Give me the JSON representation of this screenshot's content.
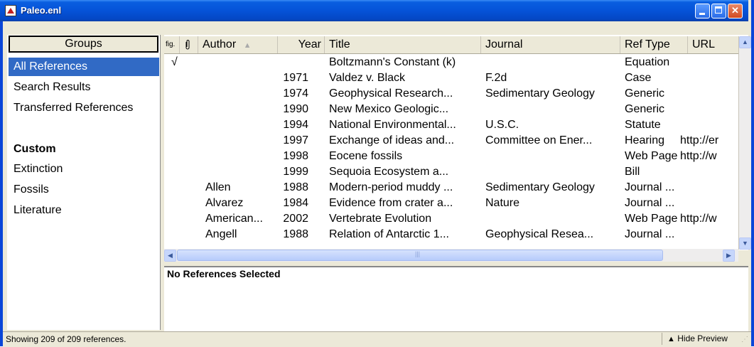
{
  "window": {
    "title": "Paleo.enl"
  },
  "groups": {
    "header": "Groups",
    "items": [
      {
        "label": "All References",
        "selected": true
      },
      {
        "label": "Search Results"
      },
      {
        "label": "Transferred References"
      }
    ],
    "custom_heading": "Custom",
    "custom_items": [
      "Extinction",
      "Fossils",
      "Literature"
    ]
  },
  "columns": {
    "figure_icon": "fig.",
    "attachment_icon": "paperclip-icon",
    "author": "Author",
    "year": "Year",
    "title": "Title",
    "journal": "Journal",
    "ref_type": "Ref Type",
    "url": "URL"
  },
  "references": [
    {
      "check": "√",
      "author": "",
      "year": "",
      "title": "Boltzmann's Constant (k)",
      "journal": "",
      "type": "Equation",
      "url": ""
    },
    {
      "check": "",
      "author": "",
      "year": "1971",
      "title": "Valdez v. Black",
      "journal": "F.2d",
      "type": "Case",
      "url": ""
    },
    {
      "check": "",
      "author": "",
      "year": "1974",
      "title": "Geophysical Research...",
      "journal": "Sedimentary Geology",
      "type": "Generic",
      "url": ""
    },
    {
      "check": "",
      "author": "",
      "year": "1990",
      "title": "New Mexico Geologic...",
      "journal": "",
      "type": "Generic",
      "url": ""
    },
    {
      "check": "",
      "author": "",
      "year": "1994",
      "title": "National Environmental...",
      "journal": "U.S.C.",
      "type": "Statute",
      "url": ""
    },
    {
      "check": "",
      "author": "",
      "year": "1997",
      "title": "Exchange of ideas and...",
      "journal": "Committee on Ener...",
      "type": "Hearing",
      "url": "http://er"
    },
    {
      "check": "",
      "author": "",
      "year": "1998",
      "title": "Eocene fossils",
      "journal": "",
      "type": "Web Page",
      "url": "http://w"
    },
    {
      "check": "",
      "author": "",
      "year": "1999",
      "title": "Sequoia Ecosystem a...",
      "journal": "",
      "type": "Bill",
      "url": ""
    },
    {
      "check": "",
      "author": "Allen",
      "year": "1988",
      "title": "Modern-period muddy ...",
      "journal": "Sedimentary Geology",
      "type": "Journal ...",
      "url": ""
    },
    {
      "check": "",
      "author": "Alvarez",
      "year": "1984",
      "title": "Evidence from crater a...",
      "journal": "Nature",
      "type": "Journal ...",
      "url": ""
    },
    {
      "check": "",
      "author": "American...",
      "year": "2002",
      "title": "Vertebrate Evolution",
      "journal": "",
      "type": "Web Page",
      "url": "http://w"
    },
    {
      "check": "",
      "author": "Angell",
      "year": "1988",
      "title": "Relation of Antarctic 1...",
      "journal": "Geophysical Resea...",
      "type": "Journal ...",
      "url": ""
    }
  ],
  "preview": {
    "text": "No References Selected"
  },
  "status": {
    "text": "Showing 209 of 209 references.",
    "hide_preview": "Hide Preview"
  }
}
